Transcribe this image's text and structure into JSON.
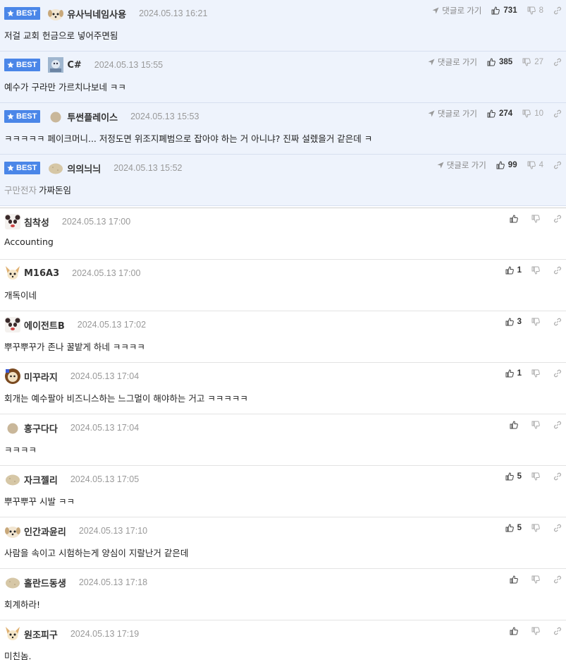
{
  "badge_label": "BEST",
  "reply_label": "댓글로 가기",
  "best_comments": [
    {
      "nick": "유사닉네임사용",
      "date": "2024.05.13 16:21",
      "text": "저걸 교회 헌금으로 넣어주면됨",
      "tag": "",
      "up": "731",
      "down": "8",
      "avatar": "dog"
    },
    {
      "nick": "C#",
      "date": "2024.05.13 15:55",
      "text": "예수가 구라만 가르치나보네 ㅋㅋ",
      "tag": "",
      "up": "385",
      "down": "27",
      "avatar": "image"
    },
    {
      "nick": "투썬플레이스",
      "date": "2024.05.13 15:53",
      "text": "ㅋㅋㅋㅋㅋ 페이크머니... 저정도면 위조지폐범으로 잡아야 하는 거 아니냐? 진짜 설렜을거 같은데 ㅋ",
      "tag": "",
      "up": "274",
      "down": "10",
      "avatar": "egg"
    },
    {
      "nick": "의의늬늬",
      "date": "2024.05.13 15:52",
      "text": "가짜돈임",
      "tag": "구만전자",
      "up": "99",
      "down": "4",
      "avatar": "potato"
    }
  ],
  "comments": [
    {
      "nick": "침착성",
      "date": "2024.05.13 17:00",
      "text": "Accounting",
      "up": "",
      "avatar": "panda"
    },
    {
      "nick": "M16A3",
      "date": "2024.05.13 17:00",
      "text": "개독이네",
      "up": "1",
      "avatar": "chihuahua"
    },
    {
      "nick": "에이전트B",
      "date": "2024.05.13 17:02",
      "text": "뿌꾸뿌꾸가 존나 꿀밭게 하네 ㅋㅋㅋㅋ",
      "up": "3",
      "avatar": "panda"
    },
    {
      "nick": "미꾸라지",
      "date": "2024.05.13 17:04",
      "text": "회개는 예수팔아 비즈니스하는 느그멀이 해야하는 거고 ㅋㅋㅋㅋㅋ",
      "up": "1",
      "avatar": "lion"
    },
    {
      "nick": "홍구다다",
      "date": "2024.05.13 17:04",
      "text": "ㅋㅋㅋㅋ",
      "up": "",
      "avatar": "egg"
    },
    {
      "nick": "자크젤리",
      "date": "2024.05.13 17:05",
      "text": "뿌꾸뿌꾸 시발 ㅋㅋ",
      "up": "5",
      "avatar": "potato"
    },
    {
      "nick": "인간과윤리",
      "date": "2024.05.13 17:10",
      "text": "사람을 속이고 시험하는게 양심이 지랄난거 같은데",
      "up": "5",
      "avatar": "dog"
    },
    {
      "nick": "홀란드동생",
      "date": "2024.05.13 17:18",
      "text": "회계하라!",
      "up": "",
      "avatar": "potato"
    },
    {
      "nick": "원조피구",
      "date": "2024.05.13 17:19",
      "text": "미친놈.",
      "up": "",
      "avatar": "chihuahua"
    }
  ]
}
